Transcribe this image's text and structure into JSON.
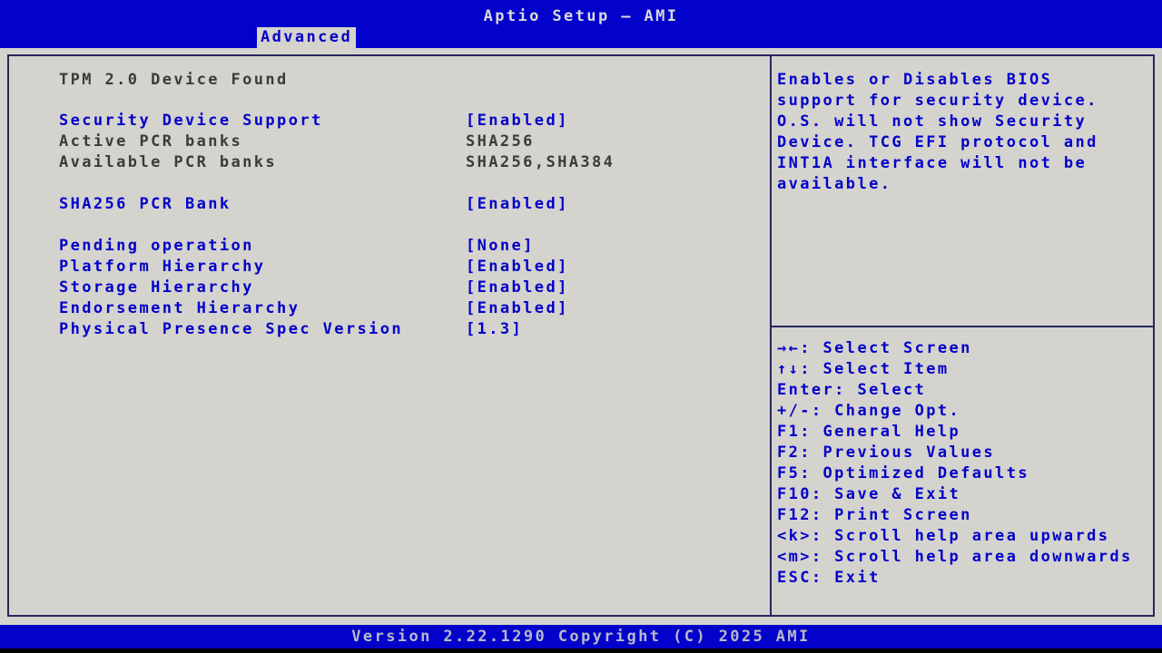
{
  "colors": {
    "bar_blue": "#0202cb",
    "panel_gray": "#d5d3ce",
    "item_blue": "#0101c9",
    "info_dark": "#3b3b3b"
  },
  "header": {
    "title": "Aptio Setup – AMI",
    "tab": "Advanced"
  },
  "left": {
    "status": "TPM 2.0 Device Found",
    "items": [
      {
        "id": "security-device-support",
        "label": "Security Device Support",
        "value": "[Enabled]",
        "type": "option",
        "spacer_before": false
      },
      {
        "id": "active-pcr-banks",
        "label": "Active PCR banks",
        "value": "SHA256",
        "type": "info",
        "spacer_before": false
      },
      {
        "id": "available-pcr-banks",
        "label": "Available PCR banks",
        "value": "SHA256,SHA384",
        "type": "info",
        "spacer_before": false
      },
      {
        "id": "sha256-pcr-bank",
        "label": "SHA256 PCR Bank",
        "value": "[Enabled]",
        "type": "option",
        "spacer_before": true
      },
      {
        "id": "pending-operation",
        "label": "Pending operation",
        "value": "[None]",
        "type": "option",
        "spacer_before": true
      },
      {
        "id": "platform-hierarchy",
        "label": "Platform Hierarchy",
        "value": "[Enabled]",
        "type": "option",
        "spacer_before": false
      },
      {
        "id": "storage-hierarchy",
        "label": "Storage Hierarchy",
        "value": "[Enabled]",
        "type": "option",
        "spacer_before": false
      },
      {
        "id": "endorsement-hierarchy",
        "label": "Endorsement Hierarchy",
        "value": "[Enabled]",
        "type": "option",
        "spacer_before": false
      },
      {
        "id": "physical-presence-spec-version",
        "label": "Physical Presence Spec Version",
        "value": "[1.3]",
        "type": "option",
        "spacer_before": false
      }
    ]
  },
  "help": {
    "text": "Enables or Disables BIOS support for security device. O.S. will not show Security Device. TCG EFI protocol and INT1A interface will not be available."
  },
  "keys": [
    {
      "id": "select-screen",
      "text": "→←: Select Screen"
    },
    {
      "id": "select-item",
      "text": "↑↓: Select Item"
    },
    {
      "id": "enter-select",
      "text": "Enter: Select"
    },
    {
      "id": "change-opt",
      "text": "+/-: Change Opt."
    },
    {
      "id": "f1-general-help",
      "text": "F1: General Help"
    },
    {
      "id": "f2-previous-values",
      "text": "F2: Previous Values"
    },
    {
      "id": "f5-optimized-defaults",
      "text": "F5: Optimized Defaults"
    },
    {
      "id": "f10-save-exit",
      "text": "F10: Save & Exit"
    },
    {
      "id": "f12-print-screen",
      "text": "F12: Print Screen"
    },
    {
      "id": "k-scroll-up",
      "text": "<k>: Scroll help area upwards"
    },
    {
      "id": "m-scroll-down",
      "text": "<m>: Scroll help area downwards"
    },
    {
      "id": "esc-exit",
      "text": "ESC: Exit"
    }
  ],
  "footer": {
    "version": "Version 2.22.1290 Copyright (C) 2025 AMI"
  }
}
